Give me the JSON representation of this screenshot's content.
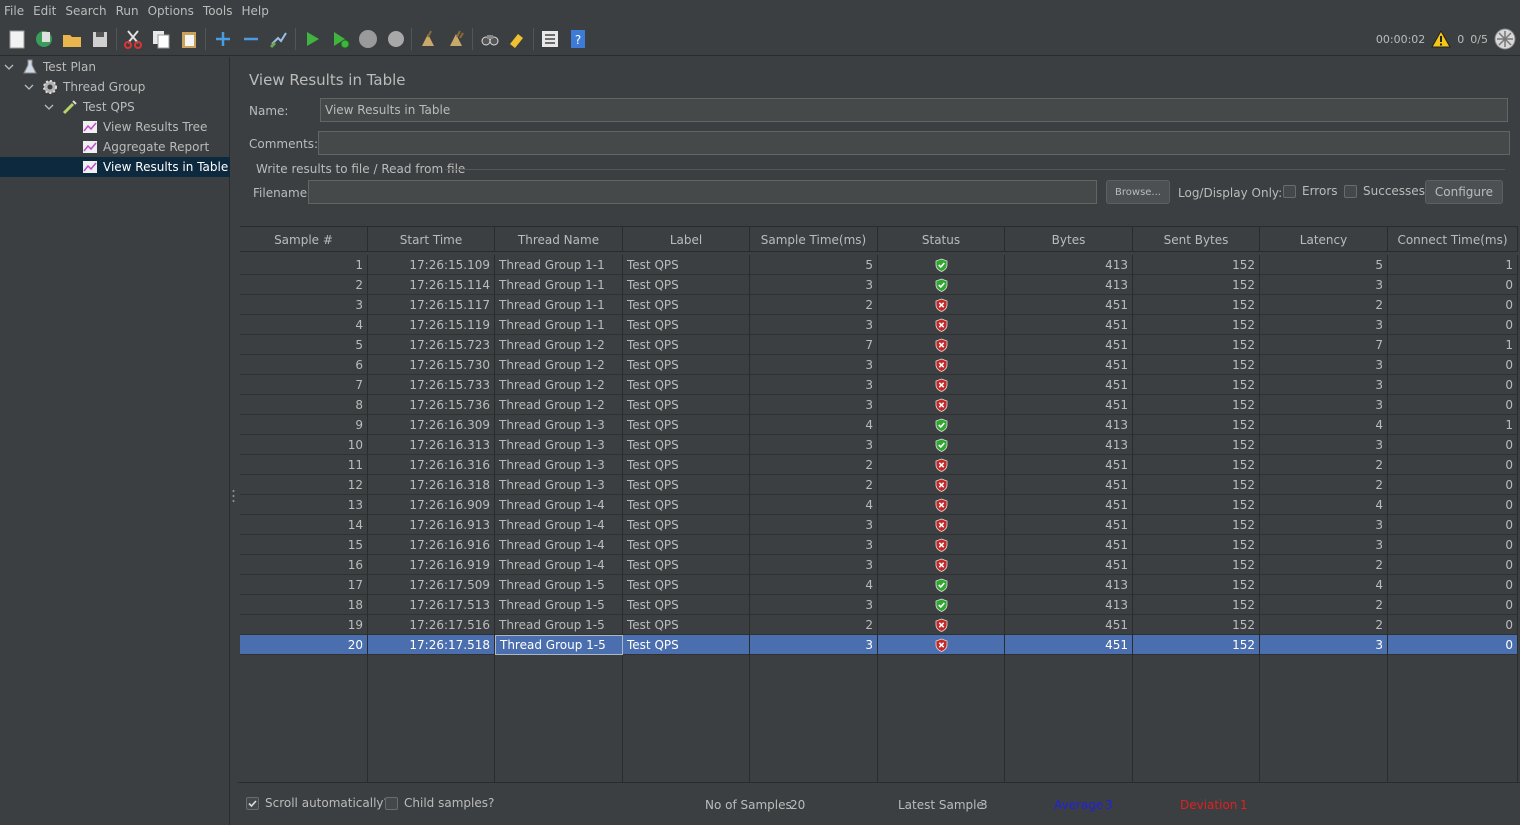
{
  "menu": [
    "File",
    "Edit",
    "Search",
    "Run",
    "Options",
    "Tools",
    "Help"
  ],
  "toolbar": {
    "buttons": [
      "new-icon",
      "templates-icon",
      "open-icon",
      "save-icon",
      "cut-icon",
      "copy-icon",
      "paste-icon",
      "expand-icon",
      "collapse-icon",
      "toggle-icon",
      "start-icon",
      "start-no-pauses-icon",
      "stop-icon",
      "shutdown-icon",
      "clear-icon",
      "clear-all-icon",
      "search-icon",
      "reset-search-icon",
      "function-helper-icon",
      "help-icon"
    ],
    "elapsed": "00:00:02",
    "warnings": "0",
    "threads": "0/5"
  },
  "tree": [
    {
      "label": "Test Plan",
      "icon": "flask-icon"
    },
    {
      "label": "Thread Group",
      "icon": "gear-icon"
    },
    {
      "label": "Test QPS",
      "icon": "pipette-icon"
    },
    {
      "label": "View Results Tree",
      "icon": "chart-icon"
    },
    {
      "label": "Aggregate Report",
      "icon": "chart-icon"
    },
    {
      "label": "View Results in Table",
      "icon": "chart-icon",
      "selected": true
    }
  ],
  "panel": {
    "title": "View Results in Table",
    "name_label": "Name:",
    "name_value": "View Results in Table",
    "comments_label": "Comments:",
    "comments_value": "",
    "file_section": "Write results to file / Read from file",
    "filename_label": "Filename",
    "filename_value": "",
    "browse": "Browse...",
    "log_display_only": "Log/Display Only:",
    "errors": "Errors",
    "successes": "Successes",
    "configure": "Configure"
  },
  "table": {
    "headers": [
      "Sample #",
      "Start Time",
      "Thread Name",
      "Label",
      "Sample Time(ms)",
      "Status",
      "Bytes",
      "Sent Bytes",
      "Latency",
      "Connect Time(ms)"
    ],
    "rows": [
      {
        "n": "1",
        "time": "17:26:15.109",
        "thread": "Thread Group 1-1",
        "label": "Test QPS",
        "ms": "5",
        "ok": true,
        "bytes": "413",
        "sent": "152",
        "lat": "5",
        "conn": "1"
      },
      {
        "n": "2",
        "time": "17:26:15.114",
        "thread": "Thread Group 1-1",
        "label": "Test QPS",
        "ms": "3",
        "ok": true,
        "bytes": "413",
        "sent": "152",
        "lat": "3",
        "conn": "0"
      },
      {
        "n": "3",
        "time": "17:26:15.117",
        "thread": "Thread Group 1-1",
        "label": "Test QPS",
        "ms": "2",
        "ok": false,
        "bytes": "451",
        "sent": "152",
        "lat": "2",
        "conn": "0"
      },
      {
        "n": "4",
        "time": "17:26:15.119",
        "thread": "Thread Group 1-1",
        "label": "Test QPS",
        "ms": "3",
        "ok": false,
        "bytes": "451",
        "sent": "152",
        "lat": "3",
        "conn": "0"
      },
      {
        "n": "5",
        "time": "17:26:15.723",
        "thread": "Thread Group 1-2",
        "label": "Test QPS",
        "ms": "7",
        "ok": false,
        "bytes": "451",
        "sent": "152",
        "lat": "7",
        "conn": "1"
      },
      {
        "n": "6",
        "time": "17:26:15.730",
        "thread": "Thread Group 1-2",
        "label": "Test QPS",
        "ms": "3",
        "ok": false,
        "bytes": "451",
        "sent": "152",
        "lat": "3",
        "conn": "0"
      },
      {
        "n": "7",
        "time": "17:26:15.733",
        "thread": "Thread Group 1-2",
        "label": "Test QPS",
        "ms": "3",
        "ok": false,
        "bytes": "451",
        "sent": "152",
        "lat": "3",
        "conn": "0"
      },
      {
        "n": "8",
        "time": "17:26:15.736",
        "thread": "Thread Group 1-2",
        "label": "Test QPS",
        "ms": "3",
        "ok": false,
        "bytes": "451",
        "sent": "152",
        "lat": "3",
        "conn": "0"
      },
      {
        "n": "9",
        "time": "17:26:16.309",
        "thread": "Thread Group 1-3",
        "label": "Test QPS",
        "ms": "4",
        "ok": true,
        "bytes": "413",
        "sent": "152",
        "lat": "4",
        "conn": "1"
      },
      {
        "n": "10",
        "time": "17:26:16.313",
        "thread": "Thread Group 1-3",
        "label": "Test QPS",
        "ms": "3",
        "ok": true,
        "bytes": "413",
        "sent": "152",
        "lat": "3",
        "conn": "0"
      },
      {
        "n": "11",
        "time": "17:26:16.316",
        "thread": "Thread Group 1-3",
        "label": "Test QPS",
        "ms": "2",
        "ok": false,
        "bytes": "451",
        "sent": "152",
        "lat": "2",
        "conn": "0"
      },
      {
        "n": "12",
        "time": "17:26:16.318",
        "thread": "Thread Group 1-3",
        "label": "Test QPS",
        "ms": "2",
        "ok": false,
        "bytes": "451",
        "sent": "152",
        "lat": "2",
        "conn": "0"
      },
      {
        "n": "13",
        "time": "17:26:16.909",
        "thread": "Thread Group 1-4",
        "label": "Test QPS",
        "ms": "4",
        "ok": false,
        "bytes": "451",
        "sent": "152",
        "lat": "4",
        "conn": "0"
      },
      {
        "n": "14",
        "time": "17:26:16.913",
        "thread": "Thread Group 1-4",
        "label": "Test QPS",
        "ms": "3",
        "ok": false,
        "bytes": "451",
        "sent": "152",
        "lat": "3",
        "conn": "0"
      },
      {
        "n": "15",
        "time": "17:26:16.916",
        "thread": "Thread Group 1-4",
        "label": "Test QPS",
        "ms": "3",
        "ok": false,
        "bytes": "451",
        "sent": "152",
        "lat": "3",
        "conn": "0"
      },
      {
        "n": "16",
        "time": "17:26:16.919",
        "thread": "Thread Group 1-4",
        "label": "Test QPS",
        "ms": "3",
        "ok": false,
        "bytes": "451",
        "sent": "152",
        "lat": "2",
        "conn": "0"
      },
      {
        "n": "17",
        "time": "17:26:17.509",
        "thread": "Thread Group 1-5",
        "label": "Test QPS",
        "ms": "4",
        "ok": true,
        "bytes": "413",
        "sent": "152",
        "lat": "4",
        "conn": "0"
      },
      {
        "n": "18",
        "time": "17:26:17.513",
        "thread": "Thread Group 1-5",
        "label": "Test QPS",
        "ms": "3",
        "ok": true,
        "bytes": "413",
        "sent": "152",
        "lat": "2",
        "conn": "0"
      },
      {
        "n": "19",
        "time": "17:26:17.516",
        "thread": "Thread Group 1-5",
        "label": "Test QPS",
        "ms": "2",
        "ok": false,
        "bytes": "451",
        "sent": "152",
        "lat": "2",
        "conn": "0"
      },
      {
        "n": "20",
        "time": "17:26:17.518",
        "thread": "Thread Group 1-5",
        "label": "Test QPS",
        "ms": "3",
        "ok": false,
        "bytes": "451",
        "sent": "152",
        "lat": "3",
        "conn": "0",
        "selected": true
      }
    ]
  },
  "status": {
    "scroll_auto": "Scroll automatically?",
    "scroll_auto_checked": true,
    "child_samples": "Child samples?",
    "child_samples_checked": false,
    "no_of_samples_label": "No of Samples",
    "no_of_samples": "20",
    "latest_sample_label": "Latest Sample",
    "latest_sample": "3",
    "average_label": "Average",
    "average": "3",
    "deviation_label": "Deviation",
    "deviation": "1",
    "average_color": "#2020e0",
    "deviation_color": "#e02020"
  }
}
